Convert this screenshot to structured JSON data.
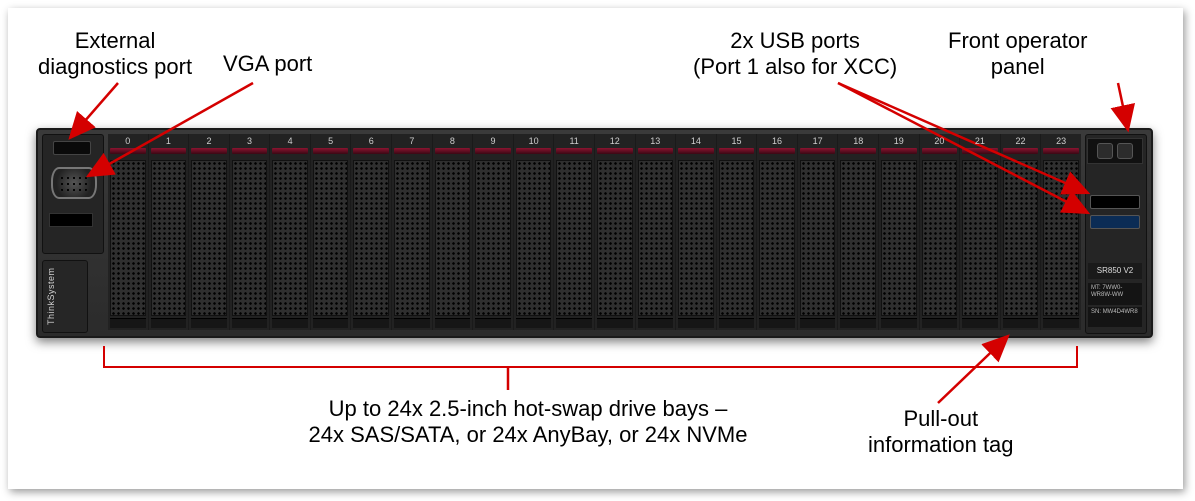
{
  "labels": {
    "ext_diag": "External\ndiagnostics port",
    "vga": "VGA port",
    "usb": "2x USB ports\n(Port 1 also for XCC)",
    "op_panel": "Front operator\npanel",
    "bays": "Up to 24x 2.5-inch hot-swap drive bays –\n24x SAS/SATA, or 24x AnyBay, or 24x NVMe",
    "pull_tag": "Pull-out\ninformation tag"
  },
  "server": {
    "brand": "ThinkSystem",
    "model": "SR850 V2",
    "mt_label": "MT:",
    "mt_value": "7WW0-\nWR8W-WW",
    "sn_label": "SN:",
    "sn_value": "MW4D4WR8",
    "bay_numbers": [
      "0",
      "1",
      "2",
      "3",
      "4",
      "5",
      "6",
      "7",
      "8",
      "9",
      "10",
      "11",
      "12",
      "13",
      "14",
      "15",
      "16",
      "17",
      "18",
      "19",
      "20",
      "21",
      "22",
      "23"
    ]
  }
}
